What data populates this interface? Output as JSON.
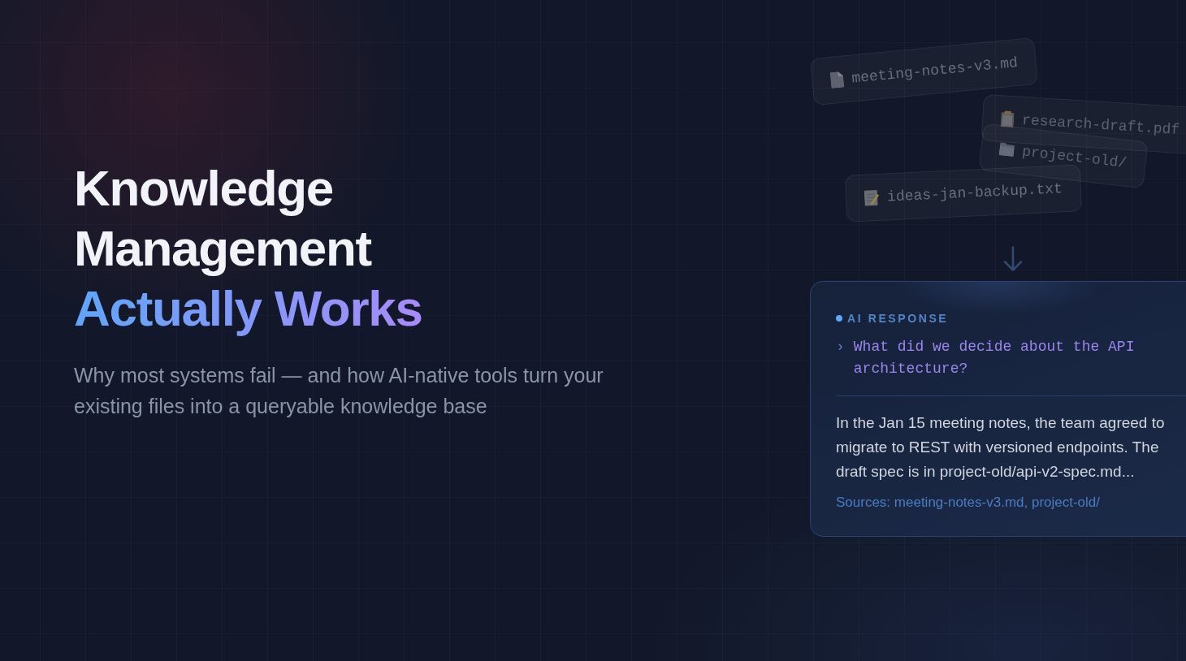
{
  "hero": {
    "title_lines": [
      "Knowledge",
      "Management"
    ],
    "highlight": "Actually Works",
    "subtitle": "Why most systems fail — and how AI-native tools turn your existing files into a queryable knowledge base"
  },
  "files": [
    {
      "name": "meeting-notes-v3.md",
      "kind": "document"
    },
    {
      "name": "research-draft.pdf",
      "kind": "pdf"
    },
    {
      "name": "project-old/",
      "kind": "folder"
    },
    {
      "name": "ideas-jan-backup.txt",
      "kind": "text"
    }
  ],
  "response_card": {
    "label": "AI RESPONSE",
    "prompt_marker": "›",
    "question": "What did we decide about the API architecture?",
    "answer": "In the Jan 15 meeting notes, the team agreed to migrate to REST with versioned endpoints. The draft spec is in project-old/api-v2-spec.md...",
    "sources": "Sources: meeting-notes-v3.md, project-old/"
  }
}
